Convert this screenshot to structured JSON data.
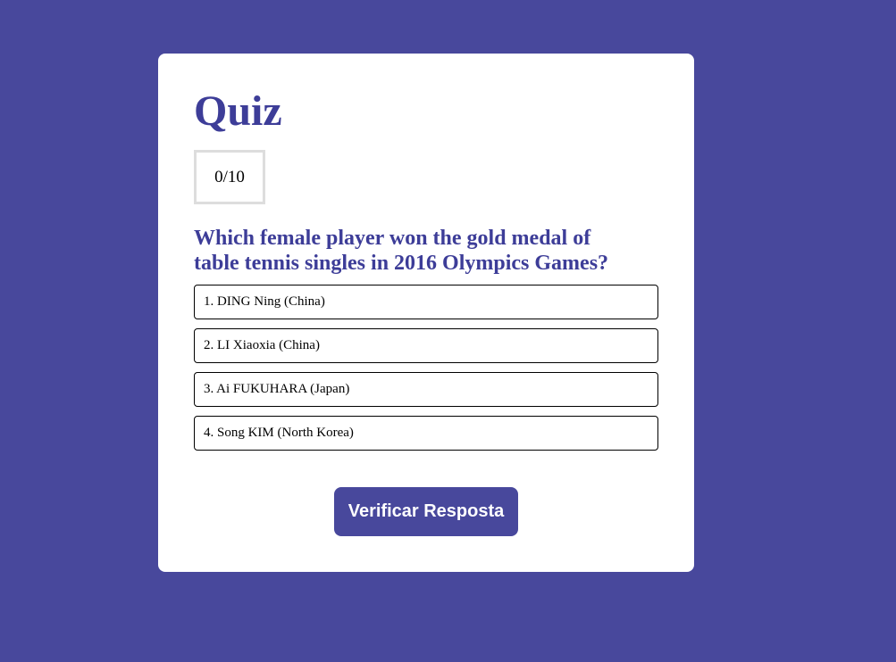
{
  "quiz": {
    "title": "Quiz",
    "score": "0/10",
    "question": "Which female player won the gold medal of table tennis singles in 2016 Olympics Games?",
    "options": [
      "1. DING Ning (China)",
      "2. LI Xiaoxia (China)",
      "3. Ai FUKUHARA (Japan)",
      "4. Song KIM (North Korea)"
    ],
    "verify_label": "Verificar Resposta"
  },
  "colors": {
    "background": "#48489c",
    "card": "#ffffff",
    "accent_text": "#3d3d98",
    "button": "#48489c"
  }
}
